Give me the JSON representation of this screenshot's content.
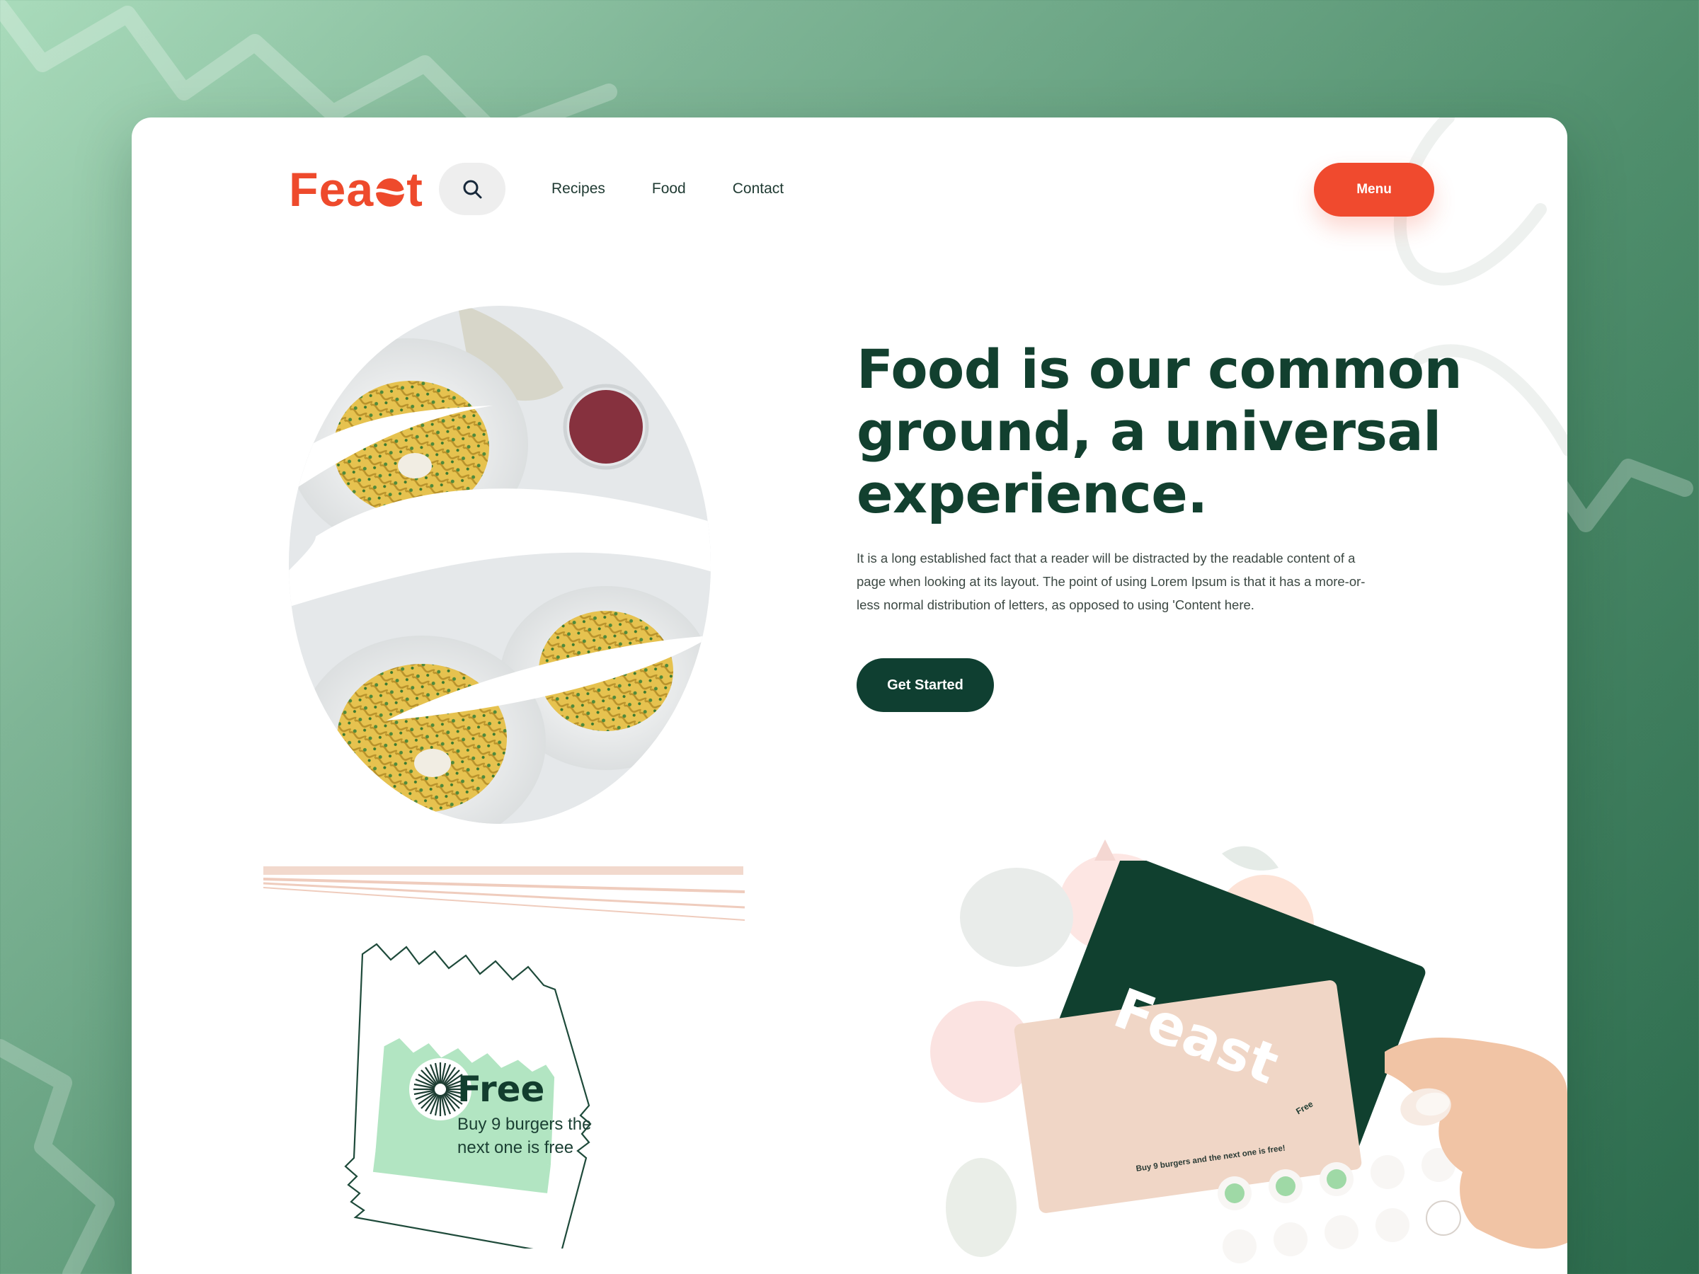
{
  "brand": {
    "name_before": "Fea",
    "name_after": "t"
  },
  "header": {
    "search_icon": "search-icon",
    "nav": [
      "Recipes",
      "Food",
      "Contact"
    ],
    "menu_label": "Menu"
  },
  "hero": {
    "title": "Food is our common ground, a universal experience.",
    "body": "It is a long established fact that a reader will be distracted by the readable content of a page when looking at its layout. The point of using Lorem Ipsum is that it has a more-or-less normal distribution of letters, as opposed to using 'Content here.",
    "cta_label": "Get Started"
  },
  "coupon": {
    "title": "Free",
    "text": "Buy 9 burgers the next one is free"
  },
  "loyalty_card": {
    "brand_text": "Feast",
    "stamp_label": "Free",
    "caption": "Buy 9 burgers and the next one is free!",
    "stamps_total": 10,
    "stamps_filled": 3
  },
  "colors": {
    "accent": "#ee4a2c",
    "dark_green": "#0f3f31",
    "mint": "#b2e5c2",
    "bg_green": "#4f8e6c"
  }
}
